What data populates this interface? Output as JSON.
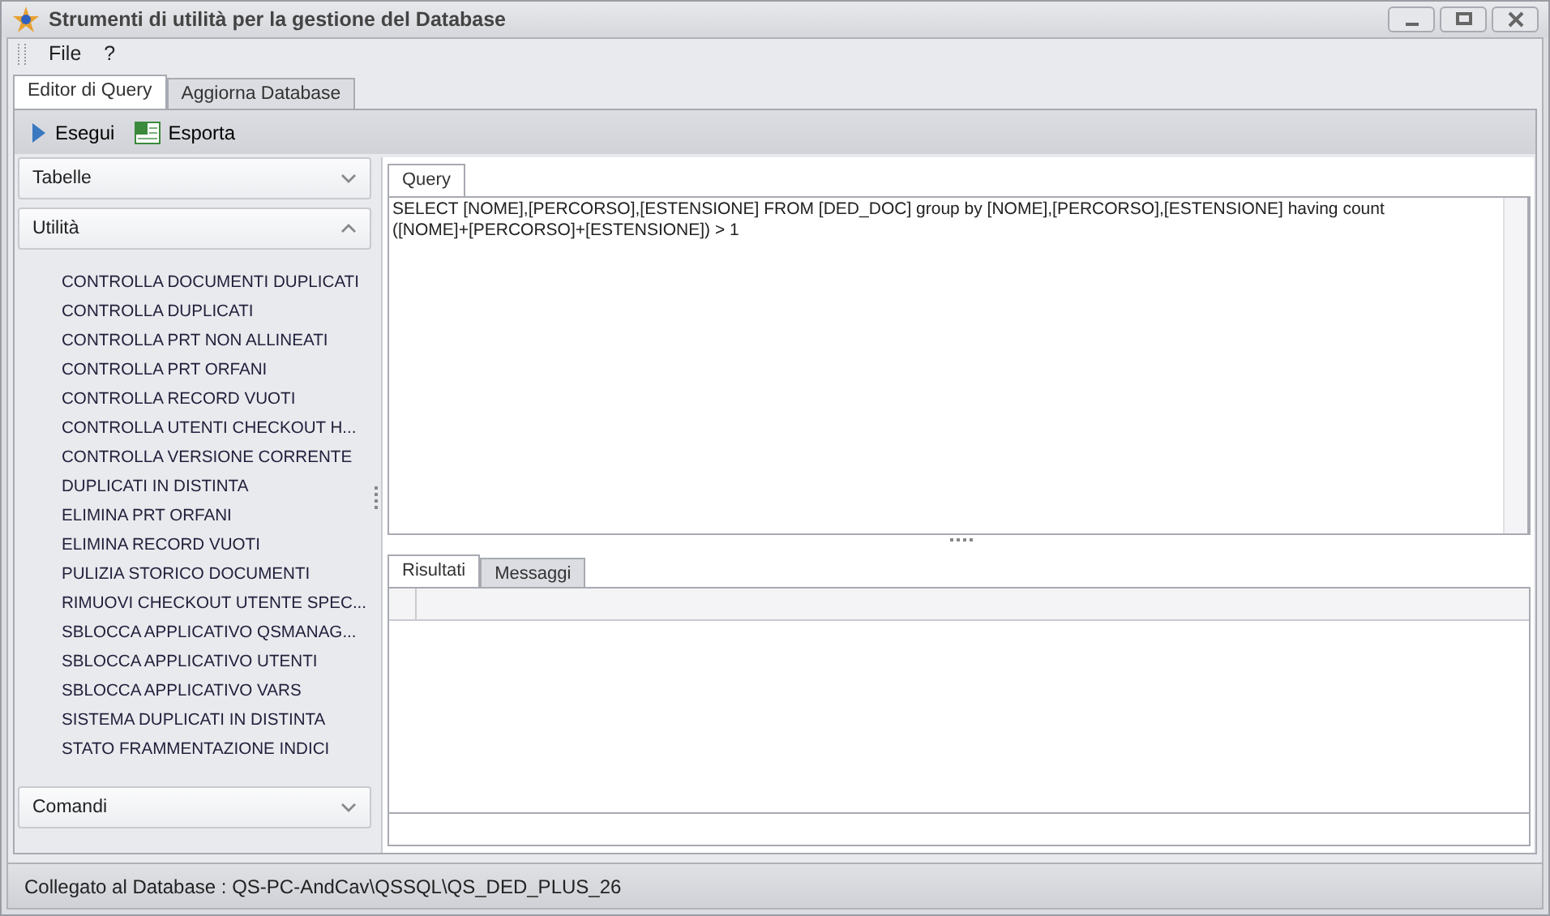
{
  "window": {
    "title": "Strumenti di utilità per la gestione del Database"
  },
  "menu": [
    "File",
    "?"
  ],
  "tabs": [
    {
      "label": "Editor di Query",
      "selected": true
    },
    {
      "label": "Aggiorna Database",
      "selected": false
    }
  ],
  "toolbar": [
    {
      "label": "Esegui",
      "kind": "run"
    },
    {
      "label": "Esporta",
      "kind": "export"
    }
  ],
  "sidebar": {
    "groups": [
      {
        "title": "Tabelle",
        "expanded": false
      },
      {
        "title": "Utilità",
        "expanded": true,
        "items": [
          "CONTROLLA DOCUMENTI DUPLICATI",
          "CONTROLLA DUPLICATI",
          "CONTROLLA PRT NON ALLINEATI",
          "CONTROLLA PRT ORFANI",
          "CONTROLLA RECORD VUOTI",
          "CONTROLLA UTENTI CHECKOUT H...",
          "CONTROLLA VERSIONE CORRENTE",
          "DUPLICATI IN DISTINTA",
          "ELIMINA PRT ORFANI",
          "ELIMINA RECORD VUOTI",
          "PULIZIA STORICO DOCUMENTI",
          "RIMUOVI CHECKOUT UTENTE SPEC...",
          "SBLOCCA APPLICATIVO QSMANAG...",
          "SBLOCCA APPLICATIVO UTENTI",
          "SBLOCCA APPLICATIVO VARS",
          "SISTEMA DUPLICATI IN DISTINTA",
          "STATO FRAMMENTAZIONE INDICI"
        ]
      },
      {
        "title": "Comandi",
        "expanded": false
      }
    ]
  },
  "editor": {
    "tab": "Query",
    "text": "SELECT [NOME],[PERCORSO],[ESTENSIONE] FROM [DED_DOC] group by [NOME],[PERCORSO],[ESTENSIONE] having count ([NOME]+[PERCORSO]+[ESTENSIONE]) > 1"
  },
  "result_tabs": [
    {
      "label": "Risultati",
      "selected": true
    },
    {
      "label": "Messaggi",
      "selected": false
    }
  ],
  "status_bar": "Collegato al Database : QS-PC-AndCav\\QSSQL\\QS_DED_PLUS_26"
}
